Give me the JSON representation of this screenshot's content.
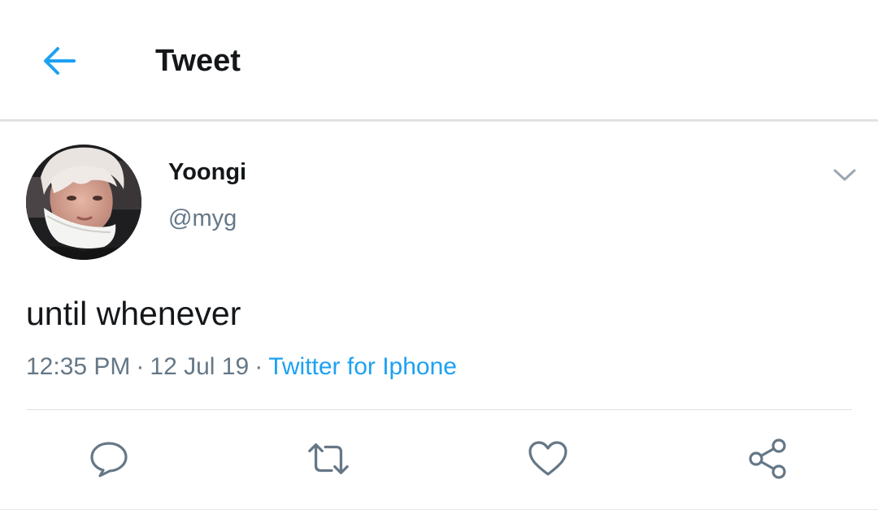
{
  "header": {
    "title": "Tweet",
    "back_icon": "arrow-left-icon",
    "accent": "#1da1f2"
  },
  "tweet": {
    "author": {
      "name": "Yoongi",
      "handle": "@myg"
    },
    "text": "until whenever",
    "time": "12:35 PM",
    "date": "12 Jul 19",
    "separator": "·",
    "source": "Twitter for Iphone"
  },
  "actions": [
    {
      "icon": "reply-icon"
    },
    {
      "icon": "retweet-icon"
    },
    {
      "icon": "like-icon"
    },
    {
      "icon": "share-icon"
    }
  ],
  "colors": {
    "text_primary": "#14171a",
    "text_secondary": "#657786",
    "link": "#1da1f2",
    "icon_gray": "#657786"
  }
}
